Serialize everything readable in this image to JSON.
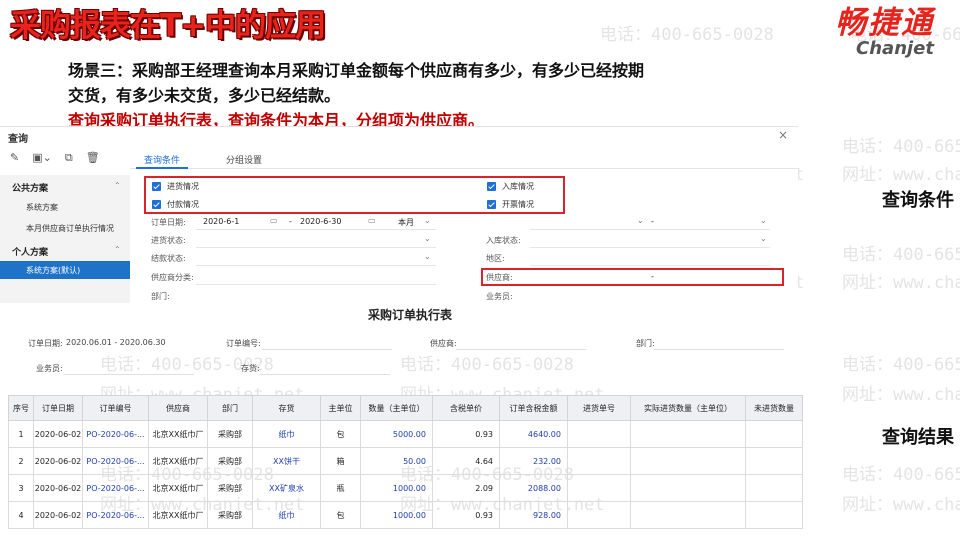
{
  "slide": {
    "title": "采购报表在T+中的应用",
    "logo_cn": "畅捷通",
    "logo_en": "Chanjet",
    "desc_line1": "场景三：采购部王经理查询本月采购订单金额每个供应商有多少，有多少已经按期",
    "desc_line2": "交货，有多少未交货，多少已经结款。",
    "desc_line3": "查询采购订单执行表，查询条件为本月，分组项为供应商。",
    "label_conditions": "查询条件",
    "label_results": "查询结果"
  },
  "watermark": {
    "phone": "电话：400-665-0028",
    "site": "网址：www.chanjet.net"
  },
  "query": {
    "window_title": "查询",
    "close": "×",
    "toolbar": {
      "edit": "✎",
      "save": "▣⌄",
      "copy": "⧉",
      "delete": "🗑"
    },
    "tabs": [
      "查询条件",
      "分组设置"
    ],
    "panel": {
      "public_header": "公共方案",
      "public_items": [
        "系统方案",
        "本月供应商订单执行情况"
      ],
      "personal_header": "个人方案",
      "selected_item": "系统方案(默认)",
      "chevron": "⌃"
    },
    "checkboxes": [
      "进货情况",
      "付款情况",
      "入库情况",
      "开票情况"
    ],
    "fields": {
      "order_date_label": "订单日期:",
      "date_from": "2020-6-1",
      "date_sep": "-",
      "date_to": "2020-6-30",
      "period": "本月",
      "stock_status": "进货状态:",
      "settle_status": "结款状态:",
      "supplier_category": "供应商分类:",
      "department": "部门:",
      "order_no": "订单编号:",
      "order_no_sep": "-",
      "warehouse_status": "入库状态:",
      "region": "地区:",
      "supplier": "供应商:",
      "supplier_sep": "-",
      "salesman": "业务员:"
    }
  },
  "report": {
    "title": "采购订单执行表",
    "meta": {
      "order_date_label": "订单日期:",
      "order_date_value": "2020.06.01 - 2020.06.30",
      "order_no_label": "订单编号:",
      "supplier_label": "供应商:",
      "dept_label": "部门:",
      "salesman_label": "业务员:",
      "stock_label": "存货:"
    },
    "columns": [
      "序号",
      "订单日期",
      "订单编号",
      "供应商",
      "部门",
      "存货",
      "主单位",
      "数量（主单位）",
      "含税单价",
      "订单含税金额",
      "进货单号",
      "实际进货数量（主单位）",
      "未进货数量"
    ],
    "rows": [
      [
        "1",
        "2020-06-02",
        "PO-2020-06-...",
        "北京XX纸巾厂",
        "采购部",
        "纸巾",
        "包",
        "5000.00",
        "0.93",
        "4640.00",
        "",
        "",
        ""
      ],
      [
        "2",
        "2020-06-02",
        "PO-2020-06-...",
        "北京XX纸巾厂",
        "采购部",
        "XX饼干",
        "箱",
        "50.00",
        "4.64",
        "232.00",
        "",
        "",
        ""
      ],
      [
        "3",
        "2020-06-02",
        "PO-2020-06-...",
        "北京XX纸巾厂",
        "采购部",
        "XX矿泉水",
        "瓶",
        "1000.00",
        "2.09",
        "2088.00",
        "",
        "",
        ""
      ],
      [
        "4",
        "2020-06-02",
        "PO-2020-06-...",
        "北京XX纸巾厂",
        "采购部",
        "纸巾",
        "包",
        "1000.00",
        "0.93",
        "928.00",
        "",
        "",
        ""
      ]
    ]
  }
}
